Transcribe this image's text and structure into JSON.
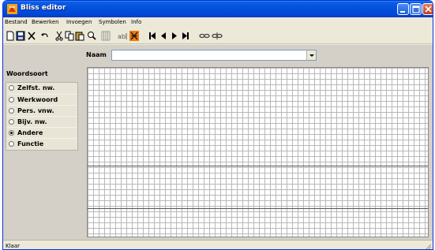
{
  "window": {
    "title": "Bliss editor",
    "icon": "bliss-app-icon",
    "buttons": [
      "minimize-icon",
      "maximize-icon",
      "close-icon"
    ]
  },
  "menu": {
    "items": [
      "Bestand",
      "Bewerken",
      "Invoegen",
      "Symbolen",
      "Info"
    ]
  },
  "toolbar": {
    "icons": [
      "new-icon",
      "save-icon",
      "delete-icon",
      "undo-icon",
      "cut-icon",
      "copy-icon",
      "paste-icon",
      "zoom-icon",
      "grid-icon",
      "rename-icon",
      "clear-icon",
      "first-icon",
      "previous-icon",
      "next-icon",
      "last-icon",
      "link-icon",
      "unlink-icon"
    ]
  },
  "naam": {
    "label": "Naam",
    "value": ""
  },
  "woordsoort": {
    "label": "Woordsoort",
    "options": [
      {
        "label": "Zelfst. nw.",
        "selected": false
      },
      {
        "label": "Werkwoord",
        "selected": false
      },
      {
        "label": "Pers. vnw.",
        "selected": false
      },
      {
        "label": "Bijv. nw.",
        "selected": false
      },
      {
        "label": "Andere",
        "selected": true
      },
      {
        "label": "Functie",
        "selected": false
      }
    ]
  },
  "status": {
    "text": "Klaar"
  },
  "colors": {
    "titlebar": "#0552dc",
    "client": "#d4d0c8",
    "grid": "#b8b8b8"
  }
}
